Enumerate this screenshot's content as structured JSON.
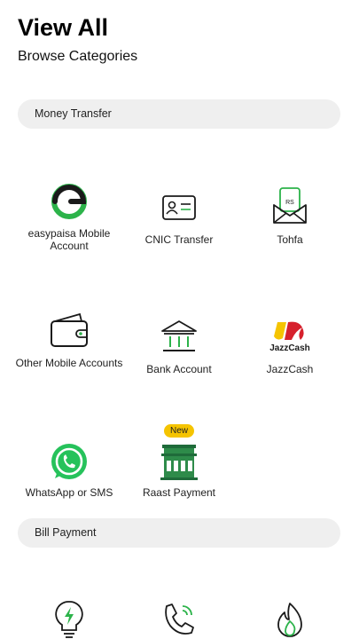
{
  "header": {
    "title": "View All",
    "subtitle": "Browse Categories"
  },
  "sections": [
    {
      "label": "Money Transfer"
    },
    {
      "label": "Bill Payment"
    }
  ],
  "money_transfer": [
    {
      "label": "easypaisa Mobile Account",
      "icon": "easypaisa-logo-icon"
    },
    {
      "label": "CNIC Transfer",
      "icon": "id-card-icon"
    },
    {
      "label": "Tohfa",
      "icon": "envelope-money-icon"
    },
    {
      "label": "Other Mobile Accounts",
      "icon": "wallet-icon"
    },
    {
      "label": "Bank Account",
      "icon": "bank-icon"
    },
    {
      "label": "JazzCash",
      "icon": "jazzcash-logo-icon"
    },
    {
      "label": "WhatsApp or SMS",
      "icon": "whatsapp-icon"
    },
    {
      "label": "Raast Payment",
      "icon": "raast-building-icon",
      "badge": "New"
    }
  ],
  "bill_payment": [
    {
      "icon": "electricity-bulb-icon"
    },
    {
      "icon": "phone-icon"
    },
    {
      "icon": "gas-flame-icon"
    }
  ],
  "colors": {
    "accent": "#2cb34a",
    "badge": "#f5c400",
    "section_bg": "#efefef"
  }
}
